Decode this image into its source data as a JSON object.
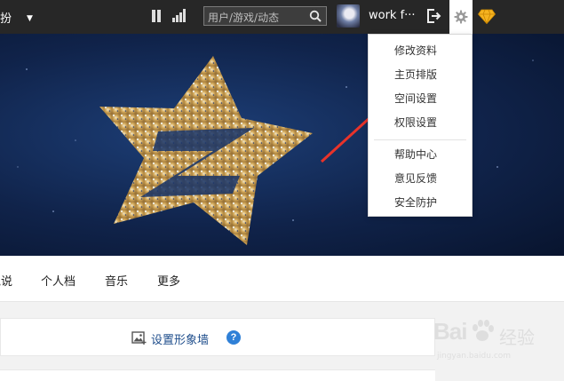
{
  "topbar": {
    "dress_label": "装扮",
    "search_placeholder": "用户/游戏/动态",
    "username": "work f···"
  },
  "settings_menu": {
    "items": [
      "修改资料",
      "主页排版",
      "空间设置",
      "权限设置",
      "帮助中心",
      "意见反馈",
      "安全防护"
    ]
  },
  "tabs": [
    "说说",
    "个人档",
    "音乐",
    "更多"
  ],
  "panel": {
    "photo_wall_link": "设置形象墙",
    "help_label": "?"
  },
  "watermark": {
    "brand": "Bai",
    "brand_cn": "经验",
    "url": "jingyan.baidu.com"
  },
  "colors": {
    "topbar_bg": "#272727",
    "annotation_arrow": "#e8332a",
    "link": "#1f4e8c",
    "help_badge": "#2f80d7"
  }
}
